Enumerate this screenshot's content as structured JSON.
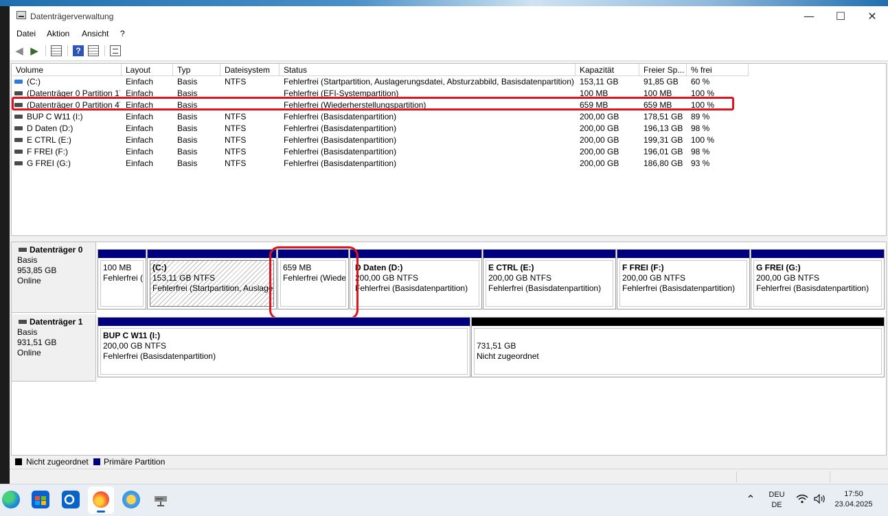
{
  "window": {
    "title": "Datenträgerverwaltung",
    "minimize": "—",
    "maximize": "☐",
    "close": "✕"
  },
  "menu": [
    "Datei",
    "Aktion",
    "Ansicht",
    "?"
  ],
  "toolbar": {
    "help": "?"
  },
  "columns": [
    "Volume",
    "Layout",
    "Typ",
    "Dateisystem",
    "Status",
    "Kapazität",
    "Freier Sp...",
    "% frei"
  ],
  "volumes": [
    {
      "volume": "(C:)",
      "layout": "Einfach",
      "typ": "Basis",
      "fs": "NTFS",
      "status": "Fehlerfrei (Startpartition, Auslagerungsdatei, Absturzabbild, Basisdatenpartition)",
      "kapazitaet": "153,11 GB",
      "frei": "91,85 GB",
      "prozent": "60 %"
    },
    {
      "volume": "(Datenträger 0 Partition 1)",
      "layout": "Einfach",
      "typ": "Basis",
      "fs": "",
      "status": "Fehlerfrei (EFI-Systempartition)",
      "kapazitaet": "100 MB",
      "frei": "100 MB",
      "prozent": "100 %"
    },
    {
      "volume": "(Datenträger 0 Partition 4)",
      "layout": "Einfach",
      "typ": "Basis",
      "fs": "",
      "status": "Fehlerfrei (Wiederherstellungspartition)",
      "kapazitaet": "659 MB",
      "frei": "659 MB",
      "prozent": "100 %"
    },
    {
      "volume": "BUP C W11  (I:)",
      "layout": "Einfach",
      "typ": "Basis",
      "fs": "NTFS",
      "status": "Fehlerfrei (Basisdatenpartition)",
      "kapazitaet": "200,00 GB",
      "frei": "178,51 GB",
      "prozent": "89 %"
    },
    {
      "volume": "D Daten (D:)",
      "layout": "Einfach",
      "typ": "Basis",
      "fs": "NTFS",
      "status": "Fehlerfrei (Basisdatenpartition)",
      "kapazitaet": "200,00 GB",
      "frei": "196,13 GB",
      "prozent": "98 %"
    },
    {
      "volume": "E CTRL (E:)",
      "layout": "Einfach",
      "typ": "Basis",
      "fs": "NTFS",
      "status": "Fehlerfrei (Basisdatenpartition)",
      "kapazitaet": "200,00 GB",
      "frei": "199,31 GB",
      "prozent": "100 %"
    },
    {
      "volume": "F FREI (F:)",
      "layout": "Einfach",
      "typ": "Basis",
      "fs": "NTFS",
      "status": "Fehlerfrei (Basisdatenpartition)",
      "kapazitaet": "200,00 GB",
      "frei": "196,01 GB",
      "prozent": "98 %"
    },
    {
      "volume": "G FREI (G:)",
      "layout": "Einfach",
      "typ": "Basis",
      "fs": "NTFS",
      "status": "Fehlerfrei (Basisdatenpartition)",
      "kapazitaet": "200,00 GB",
      "frei": "186,80 GB",
      "prozent": "93 %"
    }
  ],
  "disks": [
    {
      "name": "Datenträger 0",
      "type": "Basis",
      "size": "953,85 GB",
      "state": "Online",
      "partitions": [
        {
          "name": "",
          "size": "100 MB",
          "status": "Fehlerfrei (EFI-Systempartition)"
        },
        {
          "name": "(C:)",
          "size": "153,11 GB NTFS",
          "status": "Fehlerfrei (Startpartition, Auslagerungsdatei, Absturzabbild, Basisdatenpartition)"
        },
        {
          "name": "",
          "size": "659 MB",
          "status": "Fehlerfrei (Wiederherstellungspartition)"
        },
        {
          "name": "D Daten  (D:)",
          "size": "200,00 GB NTFS",
          "status": "Fehlerfrei (Basisdatenpartition)"
        },
        {
          "name": "E CTRL  (E:)",
          "size": "200,00 GB NTFS",
          "status": "Fehlerfrei (Basisdatenpartition)"
        },
        {
          "name": "F FREI  (F:)",
          "size": "200,00 GB NTFS",
          "status": "Fehlerfrei (Basisdatenpartition)"
        },
        {
          "name": "G FREI  (G:)",
          "size": "200,00 GB NTFS",
          "status": "Fehlerfrei (Basisdatenpartition)"
        }
      ]
    },
    {
      "name": "Datenträger 1",
      "type": "Basis",
      "size": "931,51 GB",
      "state": "Online",
      "partitions": [
        {
          "name": "BUP C W11  (I:)",
          "size": "200,00 GB NTFS",
          "status": "Fehlerfrei (Basisdatenpartition)"
        },
        {
          "name": "",
          "size": "731,51 GB",
          "status": "Nicht zugeordnet"
        }
      ]
    }
  ],
  "legend": [
    {
      "label": "Nicht zugeordnet",
      "color": "#000000"
    },
    {
      "label": "Primäre Partition",
      "color": "#00007f"
    }
  ],
  "colors": {
    "primary_partition": "#00007f",
    "unallocated": "#000000",
    "highlight": "#e0141e"
  },
  "taskbar": {
    "apps": [
      "edge-icon",
      "microsoft-store-icon",
      "outlook-icon",
      "firefox-icon",
      "weather-sun-icon",
      "network-drive-icon"
    ],
    "language_top": "DEU",
    "language_bottom": "DE",
    "chevron": "⌃",
    "time": "17:50",
    "date": "23.04.2025"
  }
}
